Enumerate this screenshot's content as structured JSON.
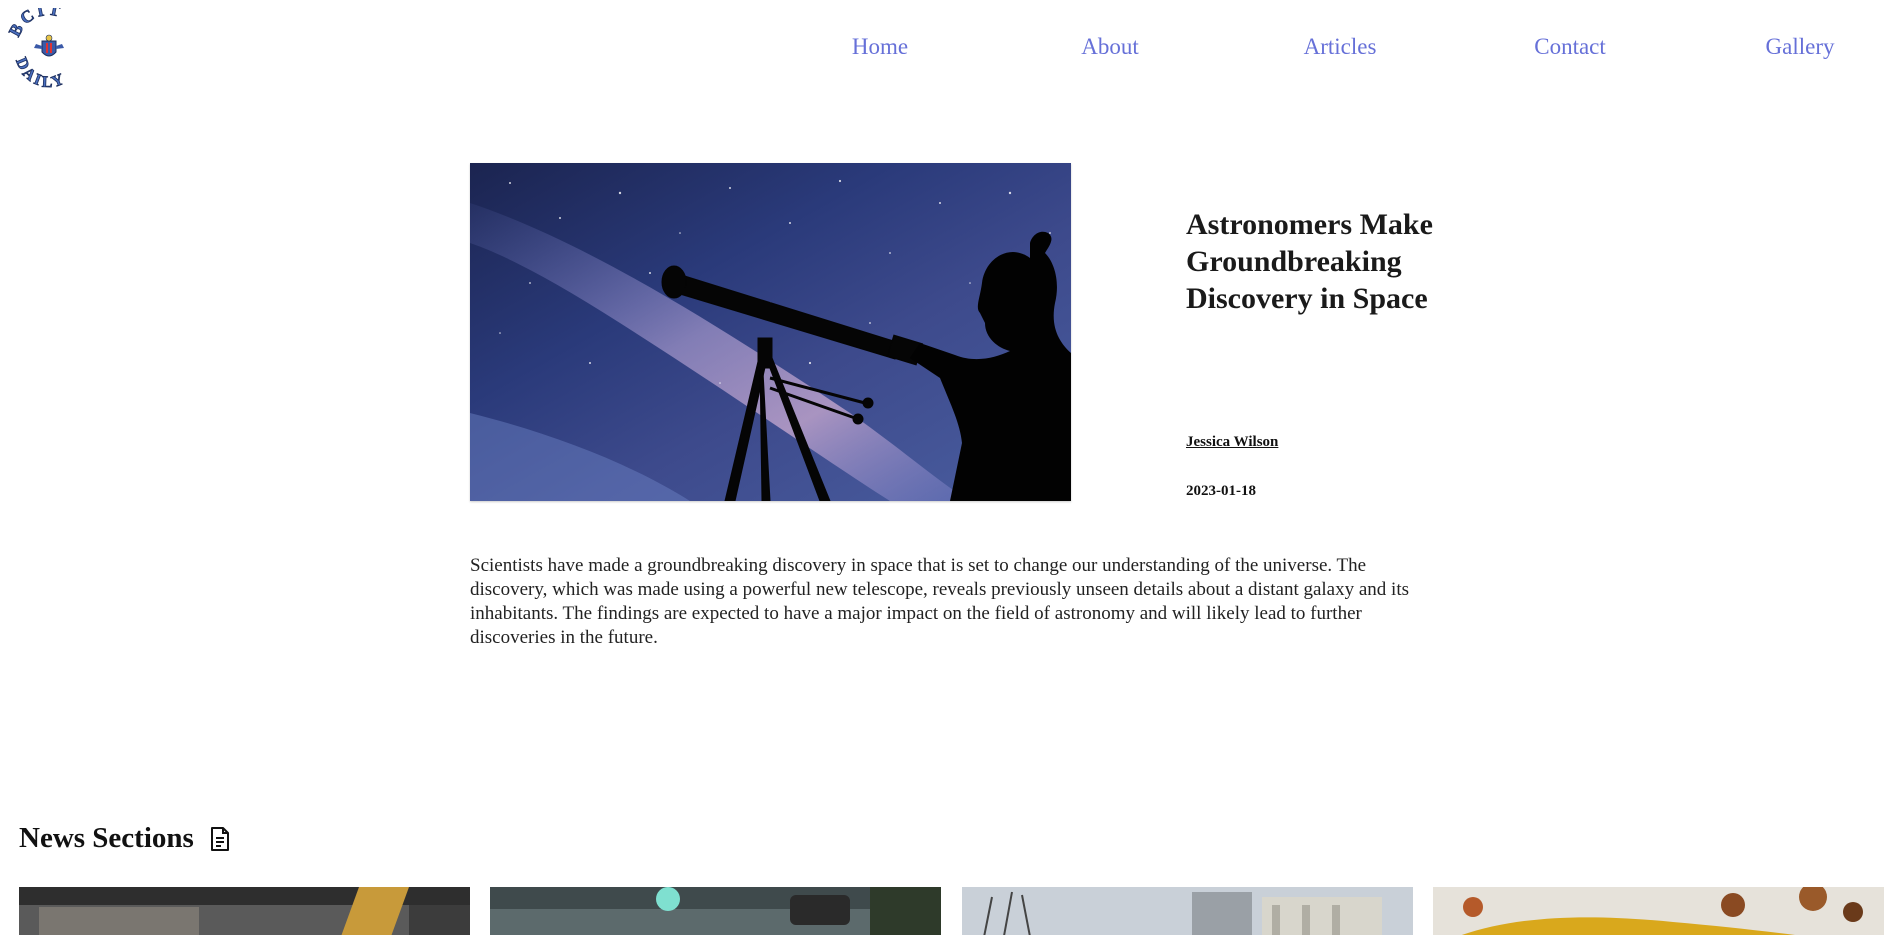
{
  "header": {
    "logo_text": "BCIT DAILY",
    "nav": [
      {
        "label": "Home"
      },
      {
        "label": "About"
      },
      {
        "label": "Articles"
      },
      {
        "label": "Contact"
      },
      {
        "label": "Gallery"
      }
    ]
  },
  "featured": {
    "title": "Astronomers Make Groundbreaking Discovery in Space",
    "author": "Jessica Wilson",
    "date": "2023-01-18",
    "summary": "Scientists have made a groundbreaking discovery in space that is set to change our understanding of the universe. The discovery, which was made using a powerful new telescope, reveals previously unseen details about a distant galaxy and its inhabitants. The findings are expected to have a major impact on the field of astronomy and will likely lead to further discoveries in the future."
  },
  "news_sections": {
    "title": "News Sections",
    "icon": "document-icon"
  },
  "colors": {
    "nav_link": "#6670d8",
    "text": "#111111",
    "background": "#ffffff"
  }
}
